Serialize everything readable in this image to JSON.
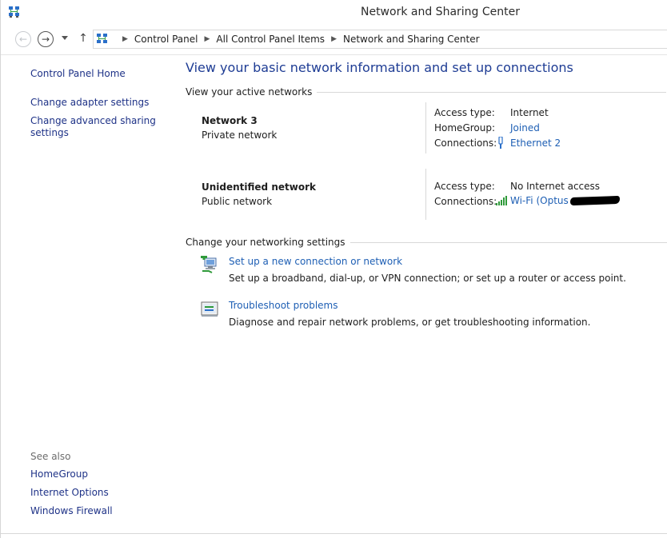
{
  "window": {
    "title": "Network and Sharing Center"
  },
  "address": {
    "crumbs": [
      "Control Panel",
      "All Control Panel Items",
      "Network and Sharing Center"
    ]
  },
  "left": {
    "links": [
      "Control Panel Home",
      "Change adapter settings",
      "Change advanced sharing",
      "settings"
    ],
    "see_also_label": "See also",
    "see_also": [
      "HomeGroup",
      "Internet Options",
      "Windows Firewall"
    ]
  },
  "main": {
    "title": "View your basic network information and set up connections",
    "active_networks_label": "View your active networks",
    "networks": [
      {
        "name": "Network  3",
        "type": "Private network",
        "access_type_label": "Access type:",
        "access_type": "Internet",
        "homegroup_label": "HomeGroup:",
        "homegroup": "Joined",
        "connections_label": "Connections:",
        "connection": "Ethernet 2"
      },
      {
        "name": "Unidentified network",
        "type": "Public network",
        "access_type_label": "Access type:",
        "access_type": "No Internet access",
        "connections_label": "Connections:",
        "connection": "Wi-Fi (Optus"
      }
    ],
    "settings_label": "Change your networking settings",
    "tasks": [
      {
        "link": "Set up a new connection or network",
        "desc": "Set up a broadband, dial-up, or VPN connection; or set up a router or access point."
      },
      {
        "link": "Troubleshoot problems",
        "desc": "Diagnose and repair network problems, or get troubleshooting information."
      }
    ]
  },
  "icons": {
    "app": "network-center-icon",
    "back": "back-arrow-icon",
    "forward": "forward-arrow-icon",
    "up": "up-arrow-icon",
    "ethernet": "ethernet-icon",
    "wifi": "wifi-signal-icon",
    "new_connection": "new-connection-icon",
    "troubleshoot": "troubleshoot-icon"
  },
  "colors": {
    "link": "#1e5fb4",
    "title": "#1e3c94",
    "nav_link": "#1e3287"
  }
}
